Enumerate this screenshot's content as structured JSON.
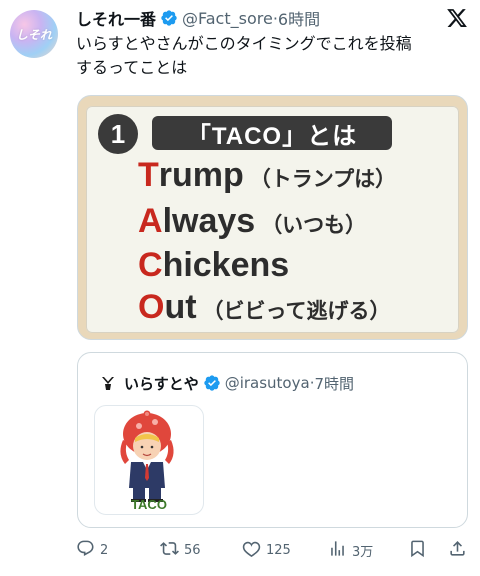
{
  "author": {
    "name": "しそれ一番",
    "handle": "@Fact_sore",
    "separator": "·",
    "time": "6時間",
    "avatar_text": "しそれ"
  },
  "tweet": {
    "text_line1": "いらすとやさんがこのタイミングでこれを投稿",
    "text_line2": "するってことは"
  },
  "media": {
    "number": "1",
    "title": "「TACO」とは",
    "lines": [
      {
        "letter": "T",
        "rest": "rump",
        "note": "（トランプは）"
      },
      {
        "letter": "A",
        "rest": "lways",
        "note": "（いつも）"
      },
      {
        "letter": "C",
        "rest": "hickens",
        "note": ""
      },
      {
        "letter": "O",
        "rest": "ut",
        "note": "（ビビって逃げる）"
      }
    ],
    "accent_color": "#c8281e"
  },
  "quote": {
    "name": "いらすとや",
    "handle": "@irasutoya",
    "separator": "·",
    "time": "7時間",
    "image_label": "TACO"
  },
  "actions": {
    "reply_count": "2",
    "retweet_count": "56",
    "like_count": "125",
    "views_count": "3万"
  },
  "icons": {
    "verified": "verified-badge-icon",
    "x_logo": "x-logo-icon",
    "reply": "reply-icon",
    "retweet": "retweet-icon",
    "like": "heart-icon",
    "views": "views-icon",
    "bookmark": "bookmark-icon",
    "share": "share-icon"
  },
  "colors": {
    "verified_blue": "#1d9bf0",
    "text_secondary": "#536471"
  }
}
